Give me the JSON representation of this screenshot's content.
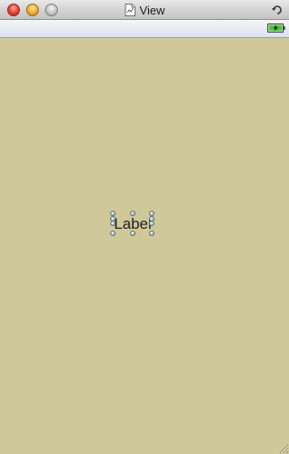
{
  "window": {
    "title": "View",
    "title_icon": "document-icon",
    "controls": [
      "close-icon",
      "minimize-icon",
      "zoom-icon"
    ],
    "rotate_icon": "rotate-icon"
  },
  "statusbar": {
    "battery_icon": "battery-charging-icon"
  },
  "content": {
    "background_color": "#cfc999",
    "label_text": "Label",
    "selection_handle_icon": "selection-handle-icon",
    "resize_icon": "resize-grip-icon"
  }
}
